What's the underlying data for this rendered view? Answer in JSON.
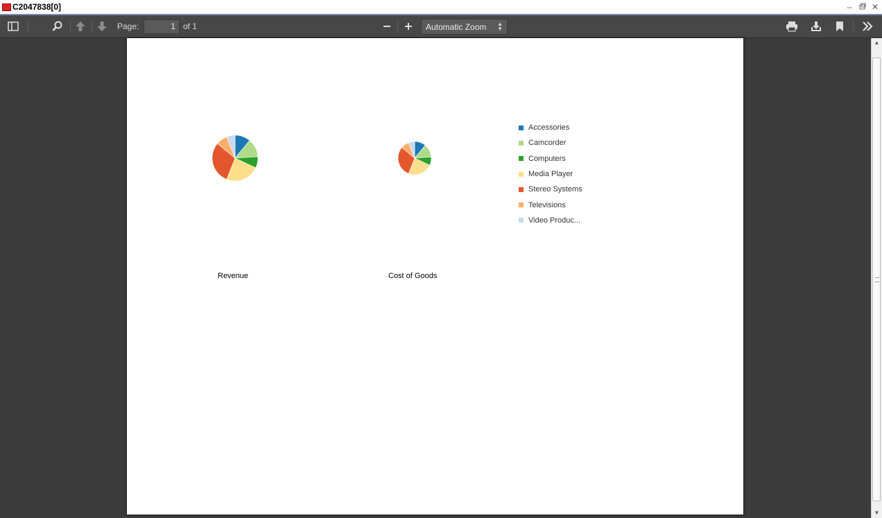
{
  "window": {
    "title": "C2047838[0]",
    "icon": "pdf-icon",
    "controls": [
      "minimize-icon",
      "restore-icon",
      "close-icon"
    ]
  },
  "toolbar": {
    "page_label": "Page:",
    "page_value": "1",
    "page_count": "of 1",
    "zoom_value": "Automatic Zoom",
    "icons": [
      "sidebar-toggle-icon",
      "search-icon",
      "arrow-up-icon",
      "arrow-down-icon",
      "zoom-out-icon",
      "zoom-in-icon",
      "print-icon",
      "download-icon",
      "bookmark-icon",
      "tools-icon"
    ]
  },
  "chart_data": [
    {
      "type": "pie",
      "title": "Revenue",
      "categories": [
        "Accessories",
        "Camcorder",
        "Computers",
        "Media Player",
        "Stereo Systems",
        "Televisions",
        "Video Produc..."
      ],
      "values": [
        11,
        13,
        8,
        24,
        30,
        8,
        6
      ]
    },
    {
      "type": "pie",
      "title": "Cost of Goods",
      "categories": [
        "Accessories",
        "Camcorder",
        "Computers",
        "Media Player",
        "Stereo Systems",
        "Televisions",
        "Video Produc..."
      ],
      "values": [
        11,
        13,
        8,
        24,
        30,
        8,
        6
      ]
    }
  ],
  "legend": {
    "items": [
      {
        "label": "Accessories",
        "color": "#1f77b4"
      },
      {
        "label": "Camcorder",
        "color": "#aedc8a"
      },
      {
        "label": "Computers",
        "color": "#2ca02c"
      },
      {
        "label": "Media Player",
        "color": "#fdde8a"
      },
      {
        "label": "Stereo Systems",
        "color": "#e4572e"
      },
      {
        "label": "Televisions",
        "color": "#fdae6b"
      },
      {
        "label": "Video Produc...",
        "color": "#c6dbef"
      }
    ]
  }
}
